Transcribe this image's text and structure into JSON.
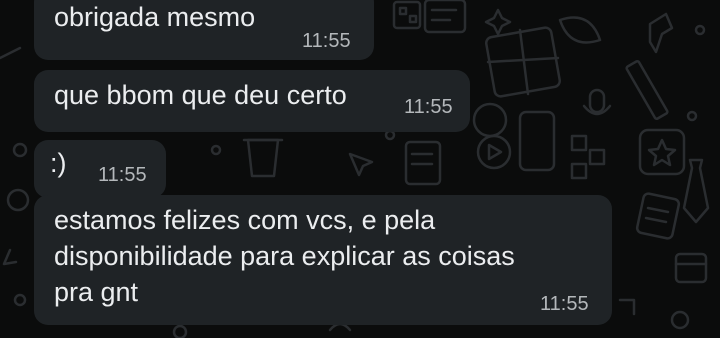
{
  "messages": [
    {
      "text": "obrigada mesmo",
      "time": "11:55"
    },
    {
      "text": "que bbom que deu certo",
      "time": "11:55"
    },
    {
      "text": ":)",
      "time": "11:55"
    },
    {
      "text": "estamos felizes com vcs, e pela\ndisponibilidade para explicar as coisas\npra gnt",
      "time": "11:55"
    }
  ],
  "colors": {
    "background": "#0b0c0c",
    "bubble": "#1f2326",
    "text": "#ebedef",
    "time": "#b4b8bb",
    "doodle": "#2a2d30"
  }
}
